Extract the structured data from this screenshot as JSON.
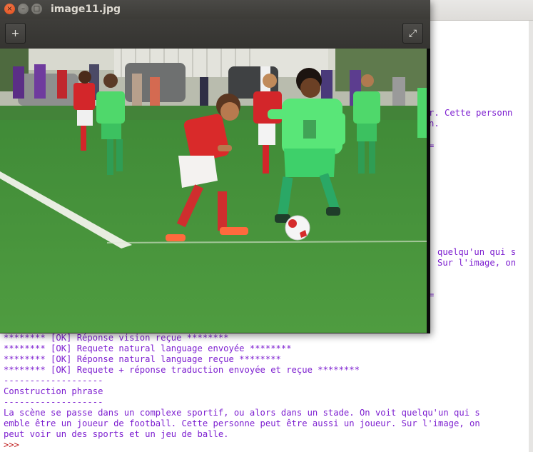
{
  "viewer": {
    "title": "image11.jpg",
    "close_glyph": "×",
    "minimize_glyph": "–",
    "maximize_glyph": "□",
    "add_glyph": "+",
    "fullscreen_glyph": "⤢",
    "photo_description_icon": "photo-soccer-match"
  },
  "terminal": {
    "text_color": "#7d1fd0",
    "prompt_color": "#c02020",
    "partial_lines": {
      "p1": "r. Cette personn",
      "p2": "n.",
      "p3": "=",
      "p4": "quelqu'un qui s",
      "p5": "Sur l'image, on",
      "p6": "="
    },
    "lines": [
      "******** [OK] Réponse vision reçue ********",
      "******** [OK] Requete natural language envoyée ********",
      "******** [OK] Réponse natural language reçue ********",
      "******** [OK] Requete + réponse traduction envoyée et reçue ********",
      "-------------------",
      "Construction phrase",
      "-------------------",
      "La scène se passe dans un complexe sportif, ou alors dans un stade. On voit quelqu'un qui s",
      "emble être un joueur de football. Cette personne peut être aussi un joueur. Sur l'image, on",
      "peut voir un des sports et un jeu de balle."
    ],
    "prompt": ">>>"
  }
}
